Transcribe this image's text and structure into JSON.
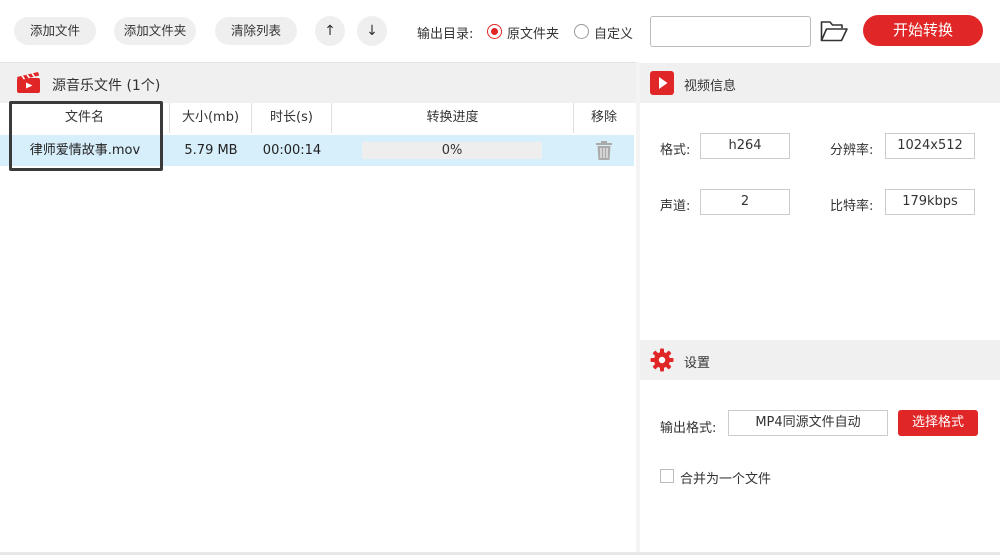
{
  "toolbar": {
    "add_file": "添加文件",
    "add_folder": "添加文件夹",
    "clear_list": "清除列表",
    "up_icon": "↑",
    "down_icon": "↓",
    "output_dir_label": "输出目录:",
    "option_source": "原文件夹",
    "option_custom": "自定义",
    "output_path": "",
    "start": "开始转换"
  },
  "file_list": {
    "title": "源音乐文件 (1个)",
    "columns": [
      "文件名",
      "大小(mb)",
      "时长(s)",
      "转换进度",
      "移除"
    ],
    "rows": [
      {
        "name": "律师爱情故事.mov",
        "size": "5.79 MB",
        "duration": "00:00:14",
        "progress": "0%",
        "progress_value": 0
      }
    ]
  },
  "video_info": {
    "title": "视频信息",
    "format_label": "格式:",
    "format_value": "h264",
    "resolution_label": "分辨率:",
    "resolution_value": "1024x512",
    "channels_label": "声道:",
    "channels_value": "2",
    "bitrate_label": "比特率:",
    "bitrate_value": "179kbps"
  },
  "settings": {
    "title": "设置",
    "output_format_label": "输出格式:",
    "output_format_value": "MP4同源文件自动",
    "choose_format": "选择格式",
    "merge_label": "合并为一个文件",
    "merge_checked": false
  },
  "colors": {
    "accent": "#e02626",
    "selected_row": "#d7eefb",
    "panel_header": "#f0f0f0"
  },
  "icons": [
    "arrow-up-icon",
    "arrow-down-icon",
    "folder-open-icon",
    "clapperboard-icon",
    "play-icon",
    "trash-icon",
    "gear-icon"
  ]
}
